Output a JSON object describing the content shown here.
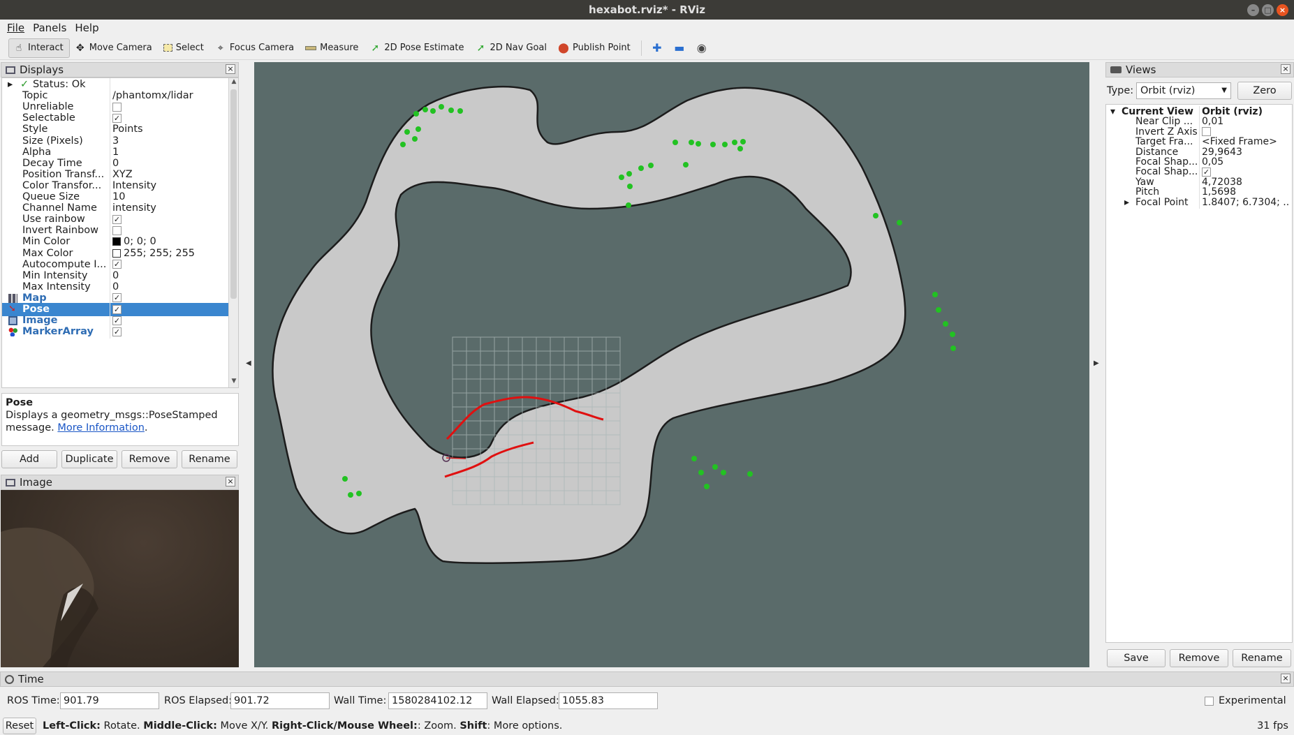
{
  "window": {
    "title": "hexabot.rviz* - RViz"
  },
  "menu": {
    "file": "File",
    "panels": "Panels",
    "help": "Help"
  },
  "toolbar": {
    "interact": "Interact",
    "move_camera": "Move Camera",
    "select": "Select",
    "focus_camera": "Focus Camera",
    "measure": "Measure",
    "pose_estimate": "2D Pose Estimate",
    "nav_goal": "2D Nav Goal",
    "publish_point": "Publish Point"
  },
  "displays": {
    "title": "Displays",
    "rows": [
      {
        "key": "Status: Ok",
        "value": ""
      },
      {
        "key": "Topic",
        "value": "/phantomx/lidar"
      },
      {
        "key": "Unreliable",
        "value": ""
      },
      {
        "key": "Selectable",
        "value": ""
      },
      {
        "key": "Style",
        "value": "Points"
      },
      {
        "key": "Size (Pixels)",
        "value": "3"
      },
      {
        "key": "Alpha",
        "value": "1"
      },
      {
        "key": "Decay Time",
        "value": "0"
      },
      {
        "key": "Position Transf...",
        "value": "XYZ"
      },
      {
        "key": "Color Transfor...",
        "value": "Intensity"
      },
      {
        "key": "Queue Size",
        "value": "10"
      },
      {
        "key": "Channel Name",
        "value": "intensity"
      },
      {
        "key": "Use rainbow",
        "value": ""
      },
      {
        "key": "Invert Rainbow",
        "value": ""
      },
      {
        "key": "Min Color",
        "value": "0; 0; 0"
      },
      {
        "key": "Max Color",
        "value": "255; 255; 255"
      },
      {
        "key": "Autocompute I...",
        "value": ""
      },
      {
        "key": "Min Intensity",
        "value": "0"
      },
      {
        "key": "Max Intensity",
        "value": "0"
      },
      {
        "key": "Map",
        "value": ""
      },
      {
        "key": "Pose",
        "value": ""
      },
      {
        "key": "Image",
        "value": ""
      },
      {
        "key": "MarkerArray",
        "value": ""
      }
    ],
    "checks": {
      "unreliable": false,
      "selectable": true,
      "use_rainbow": true,
      "invert_rainbow": false,
      "autocompute": true,
      "map": true,
      "pose": true,
      "image": true,
      "markerarray": true
    },
    "colors": {
      "min": "#000000",
      "max": "#ffffff",
      "selected_row": "#3a86cf"
    }
  },
  "description": {
    "title": "Pose",
    "text": "Displays a geometry_msgs::PoseStamped message.",
    "link": "More Information",
    "after": "."
  },
  "display_buttons": {
    "add": "Add",
    "duplicate": "Duplicate",
    "remove": "Remove",
    "rename": "Rename"
  },
  "image_panel": {
    "title": "Image"
  },
  "views": {
    "title": "Views",
    "type_label": "Type:",
    "type_value": "Orbit (rviz)",
    "zero": "Zero",
    "rows": [
      {
        "key": "Current View",
        "value": "Orbit (rviz)"
      },
      {
        "key": "Near Clip ...",
        "value": "0,01"
      },
      {
        "key": "Invert Z Axis",
        "value": ""
      },
      {
        "key": "Target Fra...",
        "value": "<Fixed Frame>"
      },
      {
        "key": "Distance",
        "value": "29,9643"
      },
      {
        "key": "Focal Shap...",
        "value": "0,05"
      },
      {
        "key": "Focal Shap...",
        "value": ""
      },
      {
        "key": "Yaw",
        "value": "4,72038"
      },
      {
        "key": "Pitch",
        "value": "1,5698"
      },
      {
        "key": "Focal Point",
        "value": "1.8407; 6.7304; ..."
      }
    ],
    "checks": {
      "invert_z": false,
      "focal_shape_fixed": true
    },
    "buttons": {
      "save": "Save",
      "remove": "Remove",
      "rename": "Rename"
    }
  },
  "time": {
    "title": "Time",
    "ros_time_label": "ROS Time:",
    "ros_time": "901.79",
    "ros_elapsed_label": "ROS Elapsed:",
    "ros_elapsed": "901.72",
    "wall_time_label": "Wall Time:",
    "wall_time": "1580284102.12",
    "wall_elapsed_label": "Wall Elapsed:",
    "wall_elapsed": "1055.83",
    "experimental": "Experimental"
  },
  "status": {
    "reset": "Reset",
    "left_click": "Left-Click:",
    "rotate": " Rotate. ",
    "middle_click": "Middle-Click:",
    "move": " Move X/Y. ",
    "right_click": "Right-Click/Mouse Wheel:",
    "zoom": ": Zoom. ",
    "shift": "Shift",
    "more": ": More options.",
    "fps": "31 fps"
  },
  "viewport_colors": {
    "background": "#5a6b6a",
    "map_free": "#c8c8c8",
    "path": "#e01010",
    "markers": "#22c222",
    "grid": "#a9b6b5"
  }
}
